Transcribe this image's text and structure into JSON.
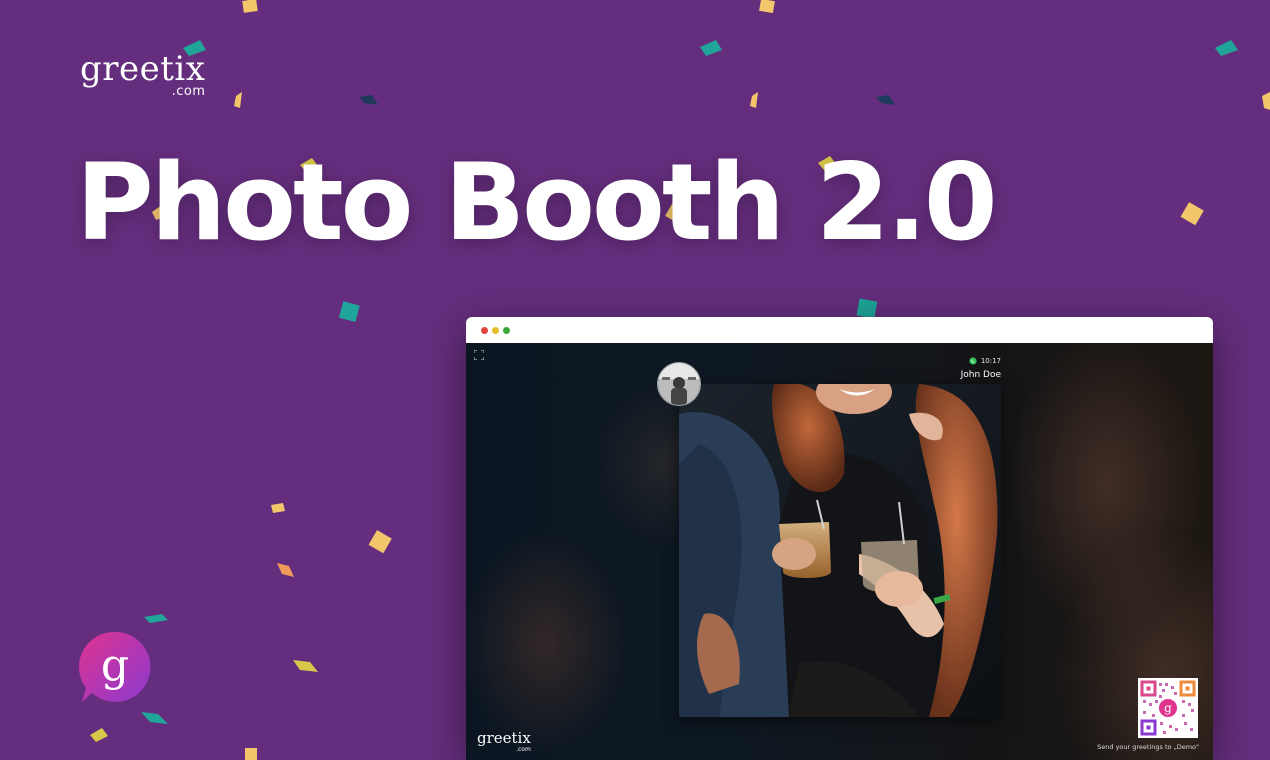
{
  "brand": {
    "logo_word": "greetix",
    "logo_domain": ".com",
    "badge_letter": "g"
  },
  "hero": {
    "headline": "Photo Booth 2.0"
  },
  "colors": {
    "background": "#652d7d",
    "confetti_teal": "#1fa59a",
    "confetti_yellow": "#f3c66b",
    "confetti_navy": "#1f3a5a",
    "badge_pink": "#e0338f",
    "badge_purple": "#8a3ad0"
  },
  "window": {
    "controls": [
      "close",
      "minimize",
      "maximize"
    ],
    "post": {
      "time": "10:17",
      "author": "John Doe",
      "channel_icon": "whatsapp-icon"
    },
    "qr_caption": "Send your greetings to „Demo\"",
    "footer_logo_word": "greetix",
    "footer_logo_domain": ".com",
    "qr_center_letter": "g"
  },
  "icons": {
    "expand": "expand-icon",
    "channel": "whatsapp-icon",
    "qr": "qr-code-icon",
    "badge": "greetix-badge-icon"
  }
}
